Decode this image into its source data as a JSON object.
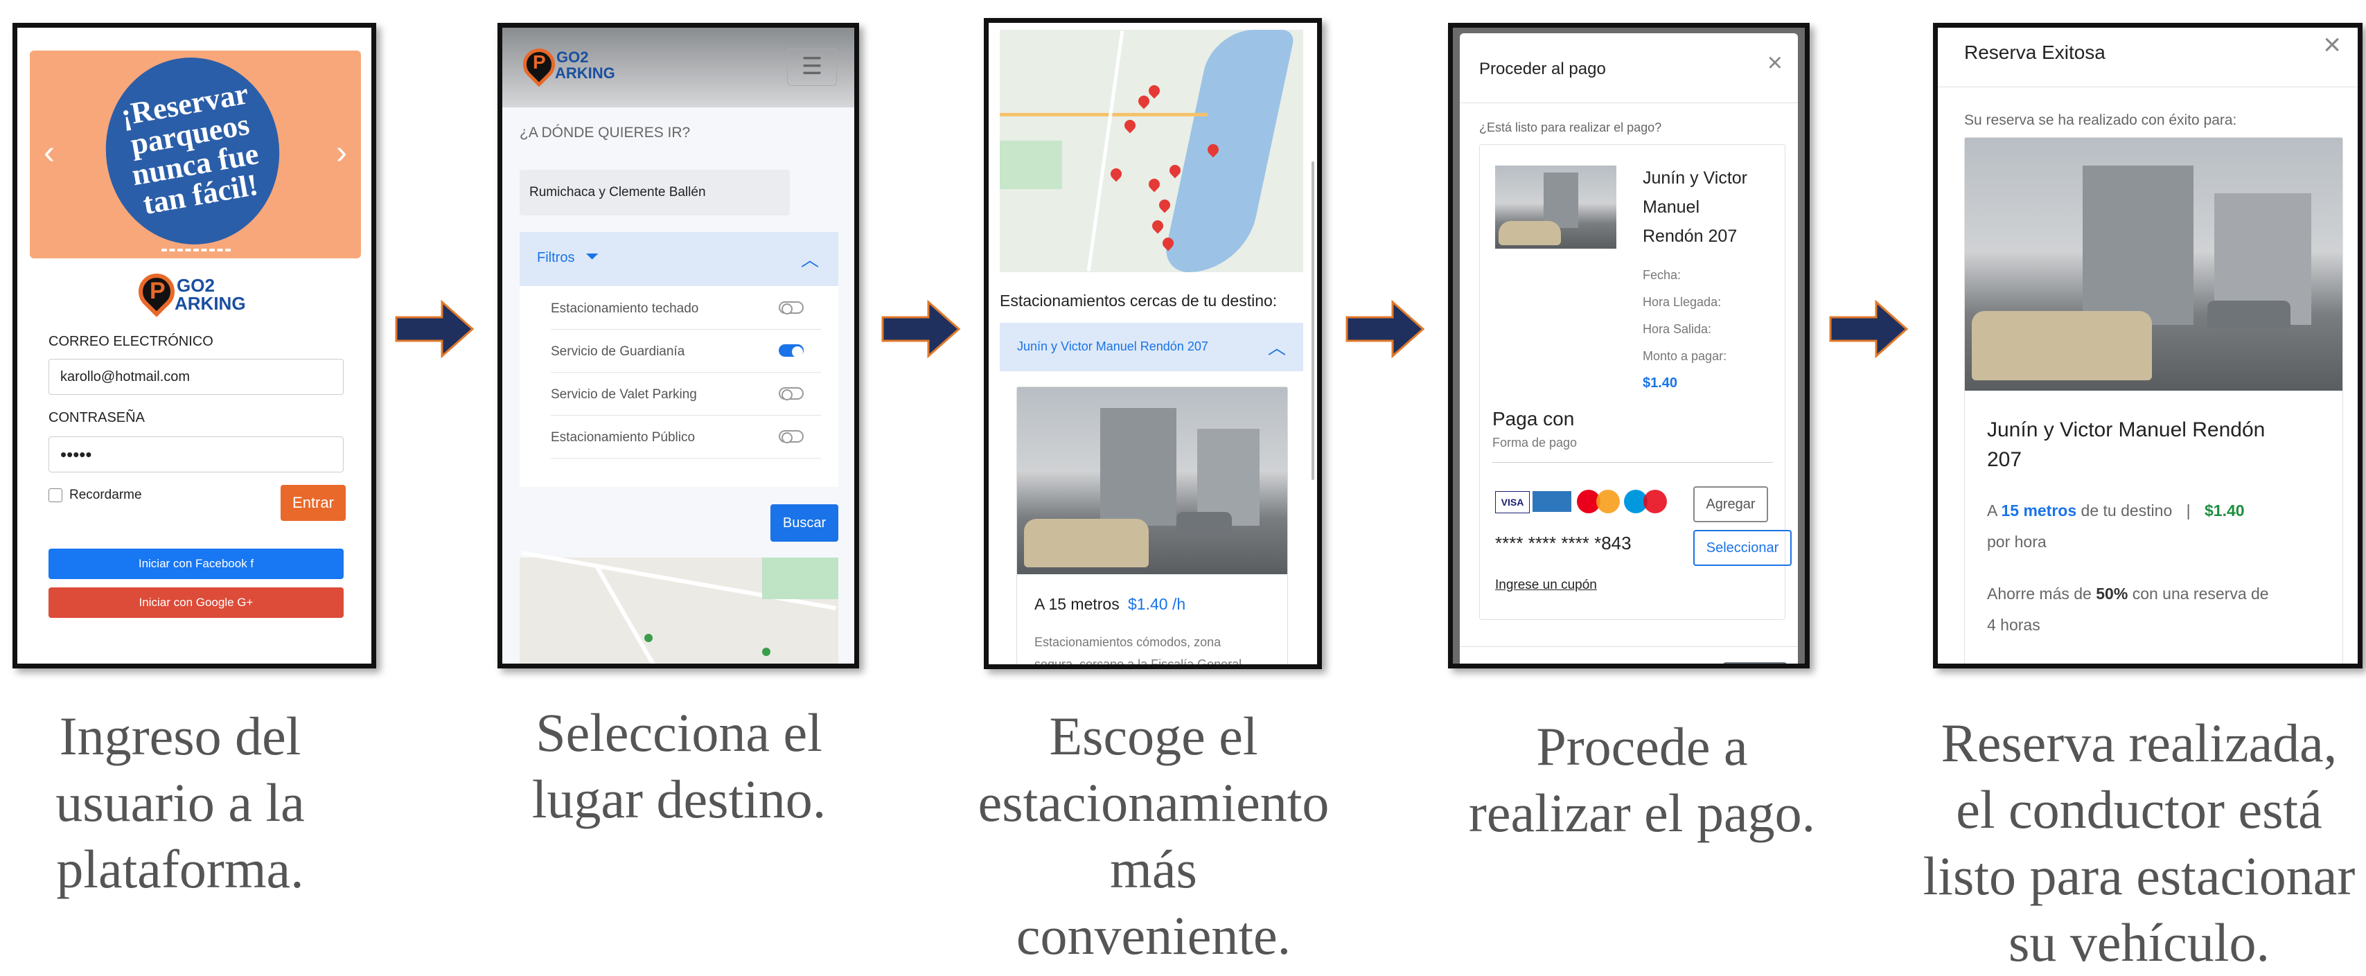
{
  "steps": [
    {
      "caption": [
        "Ingreso del",
        "usuario a la",
        "plataforma."
      ],
      "banner_text": [
        "¡Reservar",
        "parqueos",
        "nunca fue",
        "tan fácil!"
      ],
      "brand": {
        "top": "GO2",
        "bottom": "ARKING"
      },
      "email_label": "CORREO ELECTRÓNICO",
      "email_value": "karollo@hotmail.com",
      "password_label": "CONTRASEÑA",
      "password_value": "•••••",
      "remember_label": "Recordarme",
      "login_button": "Entrar",
      "facebook_button": "Iniciar con Facebook f",
      "google_button": "Iniciar con Google G+"
    },
    {
      "caption": [
        "Selecciona el",
        "lugar destino."
      ],
      "brand": {
        "top": "GO2",
        "bottom": "ARKING"
      },
      "question": "¿A DÓNDE QUIERES IR?",
      "destination_value": "Rumichaca y Clemente Ballén",
      "filters_label": "Filtros",
      "filters": [
        {
          "label": "Estacionamiento techado",
          "on": false
        },
        {
          "label": "Servicio de Guardianía",
          "on": true
        },
        {
          "label": "Servicio de Valet Parking",
          "on": false
        },
        {
          "label": "Estacionamiento Público",
          "on": false
        }
      ],
      "search_button": "Buscar"
    },
    {
      "caption": [
        "Escoge el",
        "estacionamiento",
        "más",
        "conveniente."
      ],
      "nearby_title": "Estacionamientos cercas de tu destino:",
      "lot_name": "Junín y Victor Manuel Rendón 207",
      "distance_text": "A 15 metros",
      "price_text": "$1.40 /h",
      "description": [
        "Estacionamientos cómodos, zona",
        "segura, cercano a la Fiscalía General"
      ]
    },
    {
      "caption": [
        "Procede a",
        "realizar el pago."
      ],
      "modal_title": "Proceder al pago",
      "question": "¿Está listo para realizar el pago?",
      "lot_name_lines": [
        "Junín y Victor",
        "Manuel",
        "Rendón 207"
      ],
      "details": [
        "Fecha:",
        "Hora Llegada:",
        "Hora Salida:",
        "Monto a pagar:"
      ],
      "amount": "$1.40",
      "pay_with": "Paga con",
      "payment_method": "Forma de pago",
      "card_brands": [
        "VISA",
        "AMEX",
        "MasterCard",
        "Maestro"
      ],
      "add_button": "Agregar",
      "card_number": "**** **** **** *843",
      "select_button": "Seleccionar",
      "coupon_link": "Ingrese un cupón"
    },
    {
      "caption": [
        "Reserva realizada,",
        "el conductor está",
        "listo para estacionar",
        "su vehículo."
      ],
      "modal_title": "Reserva Exitosa",
      "success_text": "Su reserva se ha realizado con éxito para:",
      "lot_name_lines": [
        "Junín y Victor Manuel Rendón",
        "207"
      ],
      "distance_prefix": "A",
      "distance": "15 metros",
      "distance_suffix": "de tu destino",
      "separator": "|",
      "price": "$1.40",
      "per_hour": "por hora",
      "savings_prefix": "Ahorre más de",
      "savings_percent": "50%",
      "savings_suffix_lines": [
        "con una reserva de",
        "4 horas"
      ]
    }
  ],
  "colors": {
    "arrow_fill": "#1f2f5e",
    "arrow_outline": "#e07a2a",
    "banner_bg": "#f7a77a",
    "banner_circle": "#2b5ea8",
    "brand_blue": "#1a4fa0",
    "entrar": "#e8692a",
    "facebook": "#1877f2",
    "google": "#dd4b39",
    "link_blue": "#1a73e8",
    "price_green": "#1e8e3e"
  },
  "icons": [
    "chevron-left-icon",
    "chevron-right-icon",
    "hamburger-icon",
    "filter-icon",
    "chevron-up-icon",
    "close-icon",
    "map-pin-icon",
    "arrow-right-icon"
  ]
}
